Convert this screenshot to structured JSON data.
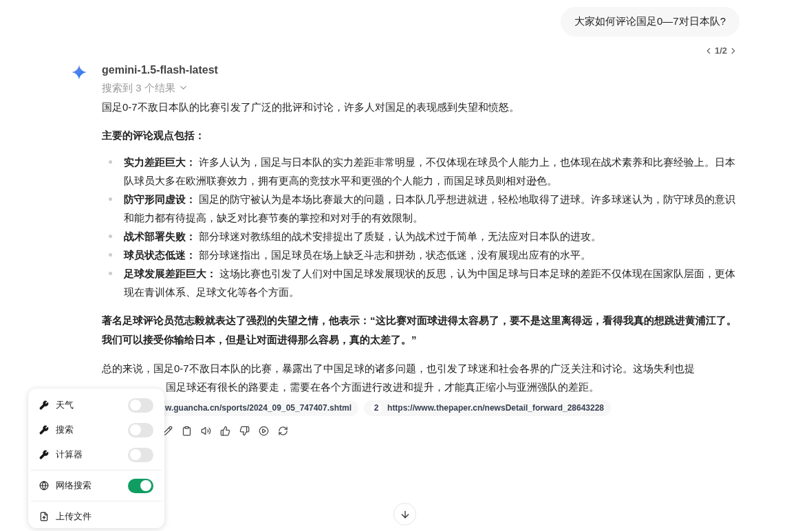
{
  "user_message": {
    "text": "大家如何评论国足0—7对日本队?",
    "pager": "1/2"
  },
  "reply": {
    "model": "gemini-1.5-flash-latest",
    "search_summary": "搜索到 3 个结果",
    "intro": "国足0-7不敌日本队的比赛引发了广泛的批评和讨论，许多人对国足的表现感到失望和愤怒。",
    "heading": "主要的评论观点包括：",
    "points": [
      {
        "title": "实力差距巨大：",
        "text": "许多人认为，国足与日本队的实力差距非常明显，不仅体现在球员个人能力上，也体现在战术素养和比赛经验上。日本队球员大多在欧洲联赛效力，拥有更高的竞技水平和更强的个人能力，而国足球员则相对逊色。"
      },
      {
        "title": "防守形同虚设：",
        "text": "国足的防守被认为是本场比赛最大的问题，日本队几乎想进就进，轻松地取得了进球。许多球迷认为，防守球员的意识和能力都有待提高，缺乏对比赛节奏的掌控和对对手的有效限制。"
      },
      {
        "title": "战术部署失败：",
        "text": "部分球迷对教练组的战术安排提出了质疑，认为战术过于简单，无法应对日本队的进攻。"
      },
      {
        "title": "球员状态低迷：",
        "text": "部分球迷指出，国足球员在场上缺乏斗志和拼劲，状态低迷，没有展现出应有的水平。"
      },
      {
        "title": "足球发展差距巨大：",
        "text": "这场比赛也引发了人们对中国足球发展现状的反思，认为中国足球与日本足球的差距不仅体现在国家队层面，更体现在青训体系、足球文化等各个方面。"
      }
    ],
    "quote": "著名足球评论员范志毅就表达了强烈的失望之情，他表示：“这比赛对面球进得太容易了，要不是这里离得远，看得我真的想跳进黄浦江了。我们可以接受你输给日本，但是让对面进得那么容易，真的太差了。”",
    "conclusion_line_1": "总的来说，国足0-7不敌日本队的比赛，暴露出了中国足球的诸多问题，也引发了球迷和社会各界的广泛关注和讨论。这场失利也提",
    "conclusion_line_2": "国足球还有很长的路要走，需要在各个方面进行改进和提升，才能真正缩小与亚洲强队的差距。",
    "sources": [
      {
        "url": "w.guancha.cn/sports/2024_09_05_747407.shtml"
      },
      {
        "number": "2",
        "url": "https://www.thepaper.cn/newsDetail_forward_28643228"
      }
    ]
  },
  "tools_menu": [
    {
      "kind": "tool",
      "label": "天气",
      "on": false
    },
    {
      "kind": "tool",
      "label": "搜索",
      "on": false
    },
    {
      "kind": "tool",
      "label": "计算器",
      "on": false
    },
    {
      "kind": "web",
      "label": "网络搜索",
      "on": true
    },
    {
      "kind": "upload",
      "label": "上传文件"
    }
  ]
}
